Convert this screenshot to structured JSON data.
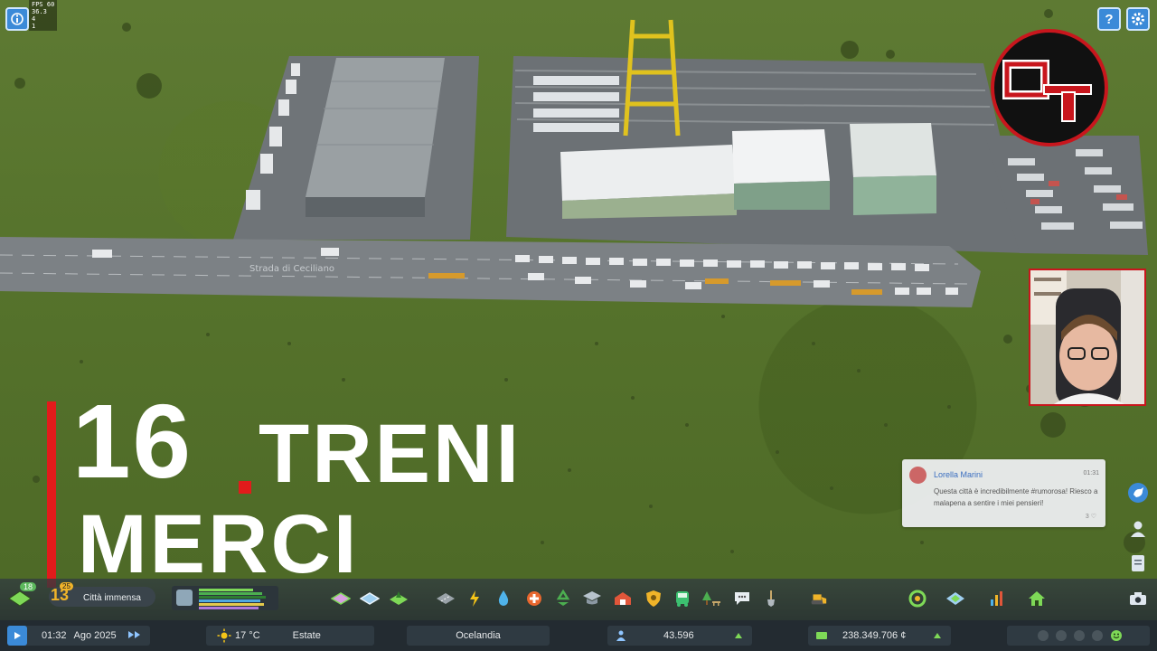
{
  "hud": {
    "fps_lines": [
      "FPS 60",
      "36.3",
      "4",
      "1"
    ],
    "help_icon": "help-icon",
    "settings_icon": "gear-icon"
  },
  "logo": {
    "text": "OT"
  },
  "map": {
    "road_name": "Strada di Ceciliano"
  },
  "title": {
    "number": "16",
    "word1": "TRENI",
    "word2": "MERCI"
  },
  "chirp": {
    "author": "Lorella Marini",
    "time": "01:31",
    "text": "Questa città è incredibilmente #rumorosa! Riesco a malapena a sentire i miei pensieri!",
    "likes": "3 ♡"
  },
  "milestone": {
    "dev_points": "18",
    "level": "13",
    "level_badge": "25",
    "name": "Città immensa"
  },
  "status": {
    "time": "01:32",
    "date": "Ago 2025",
    "temperature": "17 °C",
    "season": "Estate",
    "map_name": "Ocelandia",
    "population": "43.596",
    "money": "238.349.706 ¢"
  },
  "colors": {
    "accent_red": "#e21b1b",
    "ui_blue": "#3b8ad8",
    "status_green": "#7ed957"
  }
}
